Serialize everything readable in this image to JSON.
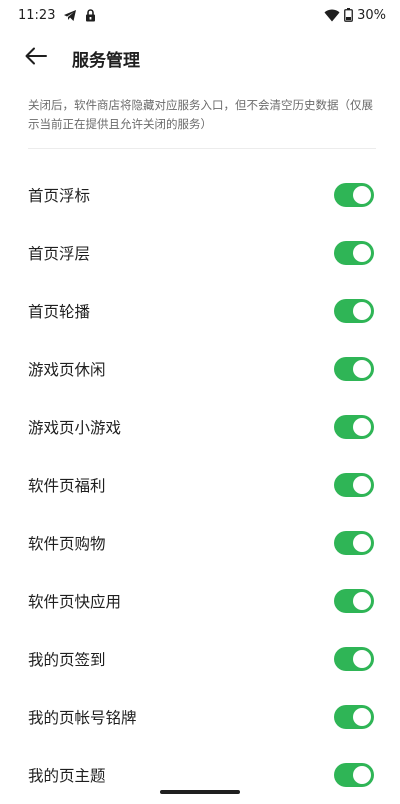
{
  "status_bar": {
    "time": "11:23",
    "battery": "30%",
    "icons": [
      "telegram-icon",
      "lock-icon",
      "wifi-icon",
      "battery-icon"
    ]
  },
  "header": {
    "title": "服务管理",
    "back_icon": "arrow-left-icon"
  },
  "description": "关闭后，软件商店将隐藏对应服务入口，但不会清空历史数据（仅展示当前正在提供且允许关闭的服务）",
  "colors": {
    "toggle_on": "#2fb556",
    "text_primary": "#1f1f1f",
    "text_secondary": "#6b6b6b"
  },
  "services": [
    {
      "label": "首页浮标",
      "enabled": true
    },
    {
      "label": "首页浮层",
      "enabled": true
    },
    {
      "label": "首页轮播",
      "enabled": true
    },
    {
      "label": "游戏页休闲",
      "enabled": true
    },
    {
      "label": "游戏页小游戏",
      "enabled": true
    },
    {
      "label": "软件页福利",
      "enabled": true
    },
    {
      "label": "软件页购物",
      "enabled": true
    },
    {
      "label": "软件页快应用",
      "enabled": true
    },
    {
      "label": "我的页签到",
      "enabled": true
    },
    {
      "label": "我的页帐号铭牌",
      "enabled": true
    },
    {
      "label": "我的页主题",
      "enabled": true
    }
  ]
}
